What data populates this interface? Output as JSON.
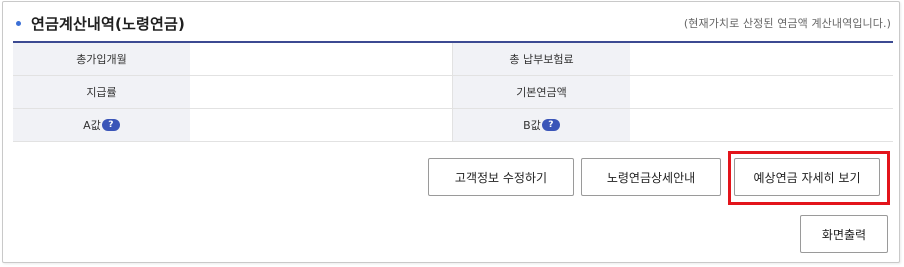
{
  "section": {
    "title": "연금계산내역(노령연금)",
    "note": "(현재가치로 산정된 연금액 계산내역입니다.)"
  },
  "table": {
    "rows": [
      {
        "left_label": "총가입개월",
        "left_value": "",
        "right_label": "총 납부보험료",
        "right_value": ""
      },
      {
        "left_label": "지급률",
        "left_value": "",
        "right_label": "기본연금액",
        "right_value": ""
      },
      {
        "left_label": "A값",
        "left_value": "",
        "right_label": "B값",
        "right_value": ""
      }
    ],
    "help_icon_text": "?"
  },
  "buttons": {
    "edit_customer": "고객정보 수정하기",
    "pension_detail": "노령연금상세안내",
    "expected_detail": "예상연금 자세히 보기",
    "print": "화면출력"
  },
  "colors": {
    "accent": "#3c4a92",
    "bullet": "#3b6fd6",
    "highlight": "#e3141b",
    "label_bg": "#f1f2f6"
  },
  "icons": {
    "help": "question-badge-icon",
    "bullet": "bullet-icon"
  }
}
